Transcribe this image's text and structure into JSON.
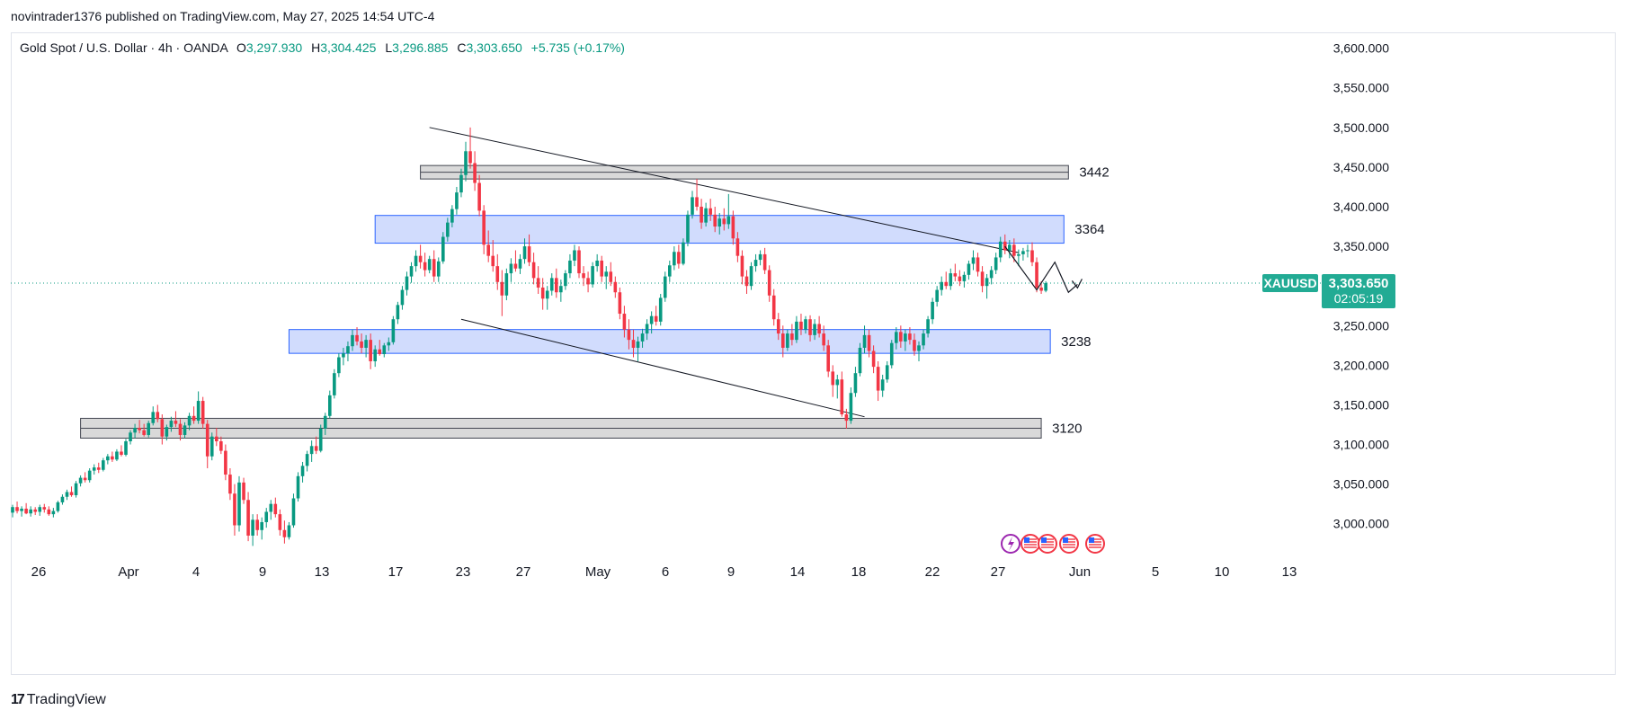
{
  "header": {
    "published_line": "novintrader1376 published on TradingView.com, May 27, 2025 14:54 UTC-4"
  },
  "legend": {
    "symbol": "Gold Spot / U.S. Dollar · 4h · OANDA",
    "o_label": "O",
    "o_value": "3,297.930",
    "h_label": "H",
    "h_value": "3,304.425",
    "l_label": "L",
    "l_value": "3,296.885",
    "c_label": "C",
    "c_value": "3,303.650",
    "change": "+5.735 (+0.17%)"
  },
  "price_tag": {
    "ticker": "XAUUSD",
    "price": "3,303.650",
    "countdown": "02:05:19"
  },
  "footer": {
    "brand": "TradingView"
  },
  "colors": {
    "up": "#089981",
    "down": "#f23645",
    "blue_zone_fill": "#d1dcfd",
    "blue_zone_stroke": "#2962ff",
    "gray_zone_fill": "#d9d9d9",
    "gray_zone_stroke": "#434651",
    "price_tag": "#22ab94",
    "grid": "#f0f3fa"
  },
  "chart_data": {
    "type": "candlestick",
    "timeframe": "4h",
    "x_tick_labels": [
      "26",
      "Apr",
      "4",
      "9",
      "13",
      "17",
      "23",
      "27",
      "May",
      "6",
      "9",
      "14",
      "18",
      "22",
      "27",
      "Jun",
      "5",
      "10",
      "13"
    ],
    "y_ticks": [
      3000,
      3050,
      3100,
      3150,
      3200,
      3250,
      3300,
      3350,
      3400,
      3450,
      3500,
      3550,
      3600
    ],
    "y_tick_labels": [
      "3,000.000",
      "3,050.000",
      "3,100.000",
      "3,150.000",
      "3,200.000",
      "3,250.000",
      "3,300.000",
      "3,350.000",
      "3,400.000",
      "3,450.000",
      "3,500.000",
      "3,550.000",
      "3,600.000"
    ],
    "ylim": [
      2960,
      3620
    ],
    "last_price": 3303.65,
    "zones": [
      {
        "label": "3442",
        "kind": "gray",
        "low": 3435,
        "high": 3452,
        "from_bar": 90,
        "to_bar": 233
      },
      {
        "label": "3364",
        "kind": "blue",
        "low": 3354,
        "high": 3389,
        "from_bar": 80,
        "to_bar": 232
      },
      {
        "label": "3238",
        "kind": "blue",
        "low": 3215,
        "high": 3245,
        "from_bar": 61,
        "to_bar": 229
      },
      {
        "label": "3120",
        "kind": "gray",
        "low": 3108,
        "high": 3133,
        "from_bar": 15,
        "to_bar": 227
      }
    ],
    "trendlines": [
      {
        "x0_bar": 92,
        "y0": 3500,
        "x1_bar": 222,
        "y1": 3342
      },
      {
        "x0_bar": 99,
        "y0": 3258,
        "x1_bar": 188,
        "y1": 3135
      }
    ],
    "projection_path": [
      {
        "bar": 219,
        "price": 3350
      },
      {
        "bar": 226,
        "price": 3295
      },
      {
        "bar": 230,
        "price": 3330
      },
      {
        "bar": 233,
        "price": 3292
      },
      {
        "bar": 235,
        "price": 3302
      }
    ],
    "candles_ohlc": [
      [
        3014,
        3024,
        3008,
        3021
      ],
      [
        3021,
        3028,
        3013,
        3016
      ],
      [
        3016,
        3022,
        3009,
        3019
      ],
      [
        3019,
        3026,
        3012,
        3013
      ],
      [
        3013,
        3022,
        3009,
        3018
      ],
      [
        3018,
        3021,
        3011,
        3015
      ],
      [
        3015,
        3024,
        3010,
        3021
      ],
      [
        3021,
        3025,
        3014,
        3018
      ],
      [
        3018,
        3022,
        3010,
        3012
      ],
      [
        3012,
        3020,
        3008,
        3016
      ],
      [
        3016,
        3029,
        3014,
        3027
      ],
      [
        3027,
        3037,
        3024,
        3034
      ],
      [
        3034,
        3043,
        3030,
        3040
      ],
      [
        3040,
        3047,
        3034,
        3036
      ],
      [
        3036,
        3054,
        3033,
        3051
      ],
      [
        3051,
        3061,
        3047,
        3058
      ],
      [
        3058,
        3065,
        3052,
        3055
      ],
      [
        3055,
        3070,
        3052,
        3067
      ],
      [
        3067,
        3075,
        3062,
        3071
      ],
      [
        3071,
        3077,
        3064,
        3068
      ],
      [
        3068,
        3083,
        3066,
        3080
      ],
      [
        3080,
        3088,
        3075,
        3085
      ],
      [
        3085,
        3091,
        3078,
        3081
      ],
      [
        3081,
        3094,
        3079,
        3091
      ],
      [
        3091,
        3099,
        3085,
        3087
      ],
      [
        3087,
        3107,
        3085,
        3104
      ],
      [
        3104,
        3118,
        3100,
        3115
      ],
      [
        3115,
        3126,
        3108,
        3121
      ],
      [
        3121,
        3131,
        3114,
        3118
      ],
      [
        3118,
        3126,
        3110,
        3112
      ],
      [
        3112,
        3130,
        3109,
        3127
      ],
      [
        3127,
        3148,
        3124,
        3141
      ],
      [
        3141,
        3150,
        3128,
        3132
      ],
      [
        3132,
        3138,
        3100,
        3110
      ],
      [
        3110,
        3125,
        3105,
        3122
      ],
      [
        3122,
        3135,
        3116,
        3130
      ],
      [
        3130,
        3142,
        3122,
        3126
      ],
      [
        3126,
        3132,
        3105,
        3112
      ],
      [
        3112,
        3128,
        3108,
        3124
      ],
      [
        3124,
        3140,
        3118,
        3136
      ],
      [
        3136,
        3148,
        3126,
        3130
      ],
      [
        3130,
        3167,
        3126,
        3155
      ],
      [
        3155,
        3160,
        3120,
        3126
      ],
      [
        3126,
        3131,
        3070,
        3085
      ],
      [
        3085,
        3115,
        3080,
        3110
      ],
      [
        3110,
        3121,
        3098,
        3104
      ],
      [
        3104,
        3110,
        3088,
        3092
      ],
      [
        3092,
        3100,
        3055,
        3062
      ],
      [
        3062,
        3070,
        3030,
        3038
      ],
      [
        3038,
        3050,
        2985,
        2998
      ],
      [
        2998,
        3060,
        2990,
        3052
      ],
      [
        3052,
        3058,
        3025,
        3030
      ],
      [
        3030,
        3040,
        2978,
        2985
      ],
      [
        2985,
        3012,
        2972,
        3005
      ],
      [
        3005,
        3012,
        2985,
        2992
      ],
      [
        2992,
        3008,
        2980,
        3002
      ],
      [
        3002,
        3020,
        2995,
        3015
      ],
      [
        3015,
        3030,
        3005,
        3025
      ],
      [
        3025,
        3033,
        3008,
        3012
      ],
      [
        3012,
        3018,
        2985,
        2992
      ],
      [
        2992,
        3004,
        2975,
        2983
      ],
      [
        2983,
        3002,
        2980,
        2998
      ],
      [
        2998,
        3038,
        2995,
        3032
      ],
      [
        3032,
        3065,
        3028,
        3060
      ],
      [
        3060,
        3078,
        3052,
        3073
      ],
      [
        3073,
        3092,
        3066,
        3088
      ],
      [
        3088,
        3105,
        3078,
        3098
      ],
      [
        3098,
        3110,
        3088,
        3092
      ],
      [
        3092,
        3125,
        3090,
        3120
      ],
      [
        3120,
        3140,
        3112,
        3136
      ],
      [
        3136,
        3168,
        3133,
        3162
      ],
      [
        3162,
        3195,
        3158,
        3190
      ],
      [
        3190,
        3215,
        3185,
        3210
      ],
      [
        3210,
        3222,
        3200,
        3215
      ],
      [
        3215,
        3230,
        3205,
        3224
      ],
      [
        3224,
        3245,
        3218,
        3238
      ],
      [
        3238,
        3248,
        3225,
        3230
      ],
      [
        3230,
        3240,
        3215,
        3222
      ],
      [
        3222,
        3238,
        3210,
        3232
      ],
      [
        3232,
        3240,
        3195,
        3205
      ],
      [
        3205,
        3225,
        3198,
        3220
      ],
      [
        3220,
        3232,
        3212,
        3214
      ],
      [
        3214,
        3228,
        3210,
        3225
      ],
      [
        3225,
        3235,
        3218,
        3229
      ],
      [
        3229,
        3262,
        3226,
        3258
      ],
      [
        3258,
        3280,
        3252,
        3276
      ],
      [
        3276,
        3300,
        3270,
        3295
      ],
      [
        3295,
        3318,
        3288,
        3312
      ],
      [
        3312,
        3330,
        3304,
        3325
      ],
      [
        3325,
        3345,
        3318,
        3338
      ],
      [
        3338,
        3352,
        3322,
        3330
      ],
      [
        3330,
        3342,
        3312,
        3320
      ],
      [
        3320,
        3338,
        3316,
        3334
      ],
      [
        3334,
        3345,
        3305,
        3312
      ],
      [
        3312,
        3336,
        3305,
        3331
      ],
      [
        3331,
        3368,
        3328,
        3362
      ],
      [
        3362,
        3386,
        3356,
        3380
      ],
      [
        3380,
        3402,
        3374,
        3397
      ],
      [
        3397,
        3425,
        3390,
        3418
      ],
      [
        3418,
        3448,
        3412,
        3440
      ],
      [
        3440,
        3482,
        3432,
        3470
      ],
      [
        3470,
        3500,
        3448,
        3455
      ],
      [
        3455,
        3470,
        3420,
        3430
      ],
      [
        3430,
        3440,
        3388,
        3395
      ],
      [
        3395,
        3402,
        3340,
        3352
      ],
      [
        3352,
        3370,
        3330,
        3338
      ],
      [
        3338,
        3358,
        3318,
        3325
      ],
      [
        3325,
        3340,
        3295,
        3305
      ],
      [
        3305,
        3320,
        3262,
        3288
      ],
      [
        3288,
        3322,
        3282,
        3316
      ],
      [
        3316,
        3335,
        3305,
        3328
      ],
      [
        3328,
        3345,
        3318,
        3322
      ],
      [
        3322,
        3340,
        3315,
        3334
      ],
      [
        3334,
        3360,
        3328,
        3350
      ],
      [
        3350,
        3365,
        3325,
        3330
      ],
      [
        3330,
        3342,
        3302,
        3310
      ],
      [
        3310,
        3325,
        3290,
        3298
      ],
      [
        3298,
        3310,
        3270,
        3284
      ],
      [
        3284,
        3300,
        3270,
        3294
      ],
      [
        3294,
        3316,
        3288,
        3310
      ],
      [
        3310,
        3322,
        3285,
        3292
      ],
      [
        3292,
        3308,
        3280,
        3300
      ],
      [
        3300,
        3320,
        3295,
        3316
      ],
      [
        3316,
        3340,
        3310,
        3332
      ],
      [
        3332,
        3352,
        3325,
        3345
      ],
      [
        3345,
        3350,
        3310,
        3316
      ],
      [
        3316,
        3325,
        3300,
        3310
      ],
      [
        3310,
        3318,
        3292,
        3302
      ],
      [
        3302,
        3330,
        3298,
        3325
      ],
      [
        3325,
        3340,
        3318,
        3332
      ],
      [
        3332,
        3338,
        3305,
        3312
      ],
      [
        3312,
        3325,
        3296,
        3318
      ],
      [
        3318,
        3330,
        3300,
        3305
      ],
      [
        3305,
        3312,
        3285,
        3292
      ],
      [
        3292,
        3298,
        3258,
        3265
      ],
      [
        3265,
        3275,
        3235,
        3245
      ],
      [
        3245,
        3258,
        3220,
        3232
      ],
      [
        3232,
        3245,
        3210,
        3222
      ],
      [
        3222,
        3236,
        3205,
        3230
      ],
      [
        3230,
        3246,
        3222,
        3240
      ],
      [
        3240,
        3258,
        3232,
        3252
      ],
      [
        3252,
        3268,
        3240,
        3262
      ],
      [
        3262,
        3275,
        3250,
        3255
      ],
      [
        3255,
        3290,
        3250,
        3285
      ],
      [
        3285,
        3318,
        3280,
        3312
      ],
      [
        3312,
        3332,
        3305,
        3326
      ],
      [
        3326,
        3350,
        3320,
        3343
      ],
      [
        3343,
        3352,
        3322,
        3328
      ],
      [
        3328,
        3360,
        3326,
        3355
      ],
      [
        3355,
        3395,
        3350,
        3390
      ],
      [
        3390,
        3420,
        3385,
        3412
      ],
      [
        3412,
        3435,
        3395,
        3400
      ],
      [
        3400,
        3410,
        3372,
        3380
      ],
      [
        3380,
        3405,
        3375,
        3398
      ],
      [
        3398,
        3410,
        3382,
        3390
      ],
      [
        3390,
        3400,
        3368,
        3375
      ],
      [
        3375,
        3392,
        3365,
        3385
      ],
      [
        3385,
        3398,
        3370,
        3378
      ],
      [
        3378,
        3416,
        3372,
        3388
      ],
      [
        3388,
        3395,
        3352,
        3360
      ],
      [
        3360,
        3368,
        3330,
        3338
      ],
      [
        3338,
        3345,
        3302,
        3312
      ],
      [
        3312,
        3320,
        3290,
        3300
      ],
      [
        3300,
        3330,
        3295,
        3325
      ],
      [
        3325,
        3340,
        3318,
        3333
      ],
      [
        3333,
        3345,
        3326,
        3340
      ],
      [
        3340,
        3348,
        3315,
        3320
      ],
      [
        3320,
        3326,
        3280,
        3288
      ],
      [
        3288,
        3296,
        3250,
        3258
      ],
      [
        3258,
        3266,
        3232,
        3240
      ],
      [
        3240,
        3250,
        3210,
        3222
      ],
      [
        3222,
        3245,
        3218,
        3240
      ],
      [
        3240,
        3252,
        3225,
        3232
      ],
      [
        3232,
        3262,
        3228,
        3255
      ],
      [
        3255,
        3265,
        3238,
        3245
      ],
      [
        3245,
        3262,
        3240,
        3258
      ],
      [
        3258,
        3263,
        3230,
        3238
      ],
      [
        3238,
        3258,
        3232,
        3252
      ],
      [
        3252,
        3262,
        3235,
        3240
      ],
      [
        3240,
        3250,
        3218,
        3225
      ],
      [
        3225,
        3232,
        3185,
        3192
      ],
      [
        3192,
        3200,
        3160,
        3175
      ],
      [
        3175,
        3188,
        3158,
        3182
      ],
      [
        3182,
        3192,
        3135,
        3138
      ],
      [
        3138,
        3145,
        3120,
        3130
      ],
      [
        3130,
        3172,
        3126,
        3165
      ],
      [
        3165,
        3198,
        3160,
        3190
      ],
      [
        3190,
        3228,
        3186,
        3222
      ],
      [
        3222,
        3250,
        3215,
        3238
      ],
      [
        3238,
        3245,
        3210,
        3218
      ],
      [
        3218,
        3225,
        3190,
        3198
      ],
      [
        3198,
        3205,
        3155,
        3168
      ],
      [
        3168,
        3188,
        3160,
        3182
      ],
      [
        3182,
        3205,
        3178,
        3200
      ],
      [
        3200,
        3232,
        3196,
        3228
      ],
      [
        3228,
        3248,
        3220,
        3242
      ],
      [
        3242,
        3250,
        3222,
        3230
      ],
      [
        3230,
        3245,
        3218,
        3240
      ],
      [
        3240,
        3248,
        3226,
        3232
      ],
      [
        3232,
        3240,
        3212,
        3218
      ],
      [
        3218,
        3230,
        3205,
        3225
      ],
      [
        3225,
        3245,
        3220,
        3240
      ],
      [
        3240,
        3262,
        3235,
        3258
      ],
      [
        3258,
        3285,
        3252,
        3280
      ],
      [
        3280,
        3300,
        3274,
        3295
      ],
      [
        3295,
        3312,
        3288,
        3305
      ],
      [
        3305,
        3318,
        3296,
        3300
      ],
      [
        3300,
        3322,
        3295,
        3316
      ],
      [
        3316,
        3328,
        3306,
        3312
      ],
      [
        3312,
        3320,
        3300,
        3306
      ],
      [
        3306,
        3318,
        3298,
        3314
      ],
      [
        3314,
        3332,
        3308,
        3328
      ],
      [
        3328,
        3345,
        3320,
        3336
      ],
      [
        3336,
        3342,
        3312,
        3318
      ],
      [
        3318,
        3325,
        3292,
        3300
      ],
      [
        3300,
        3315,
        3284,
        3310
      ],
      [
        3310,
        3325,
        3302,
        3320
      ],
      [
        3320,
        3342,
        3315,
        3336
      ],
      [
        3336,
        3362,
        3330,
        3356
      ],
      [
        3356,
        3365,
        3340,
        3345
      ],
      [
        3345,
        3358,
        3335,
        3352
      ],
      [
        3352,
        3360,
        3330,
        3338
      ],
      [
        3338,
        3346,
        3325,
        3340
      ],
      [
        3340,
        3348,
        3332,
        3344
      ],
      [
        3344,
        3352,
        3336,
        3345
      ],
      [
        3345,
        3355,
        3325,
        3330
      ],
      [
        3330,
        3336,
        3292,
        3298
      ],
      [
        3298,
        3306,
        3290,
        3294
      ],
      [
        3294,
        3306,
        3292,
        3303.65
      ]
    ]
  }
}
